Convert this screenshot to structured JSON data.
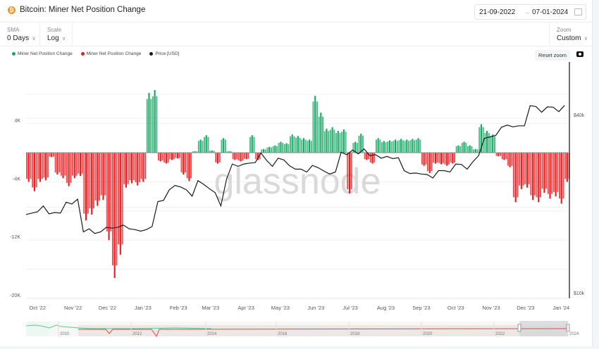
{
  "header": {
    "title": "Bitcoin: Miner Net Position Change",
    "coin_icon": "bitcoin-icon",
    "date_from": "21-09-2022",
    "date_to": "07-01-2024",
    "arrow": "→"
  },
  "controls": {
    "sma": {
      "label": "SMA",
      "value": "0 Days"
    },
    "scale": {
      "label": "Scale",
      "value": "Log"
    },
    "zoom": {
      "label": "Zoom",
      "value": "Custom"
    }
  },
  "toolbar": {
    "reset_zoom": "Reset zoom"
  },
  "legend": [
    {
      "label": "Miner Net Position Change",
      "color": "#16a864"
    },
    {
      "label": "Miner Net Position Change",
      "color": "#f0191c"
    },
    {
      "label": "Price [USD]",
      "color": "#1a1a1a"
    }
  ],
  "watermark": "glassnode",
  "chart_data": {
    "type": "bar",
    "title": "Bitcoin: Miner Net Position Change",
    "x_start": "2022-09-21",
    "x_step_days": 5,
    "ylim": [
      -20000,
      12000
    ],
    "left_ticks": [
      {
        "v": 4000,
        "label": "4K"
      },
      {
        "v": -4000,
        "label": "-4K"
      },
      {
        "v": -12000,
        "label": "-12K"
      },
      {
        "v": -20000,
        "label": "-20K"
      }
    ],
    "right_axis": {
      "scale": "log",
      "ticks": [
        {
          "v": 40000,
          "label": "$40k"
        },
        {
          "v": 10000,
          "label": "$10k"
        }
      ]
    },
    "x_ticks": [
      "Oct '22",
      "Nov '22",
      "Dec '22",
      "Jan '23",
      "Feb '23",
      "Mar '23",
      "Apr '23",
      "May '23",
      "Jun '23",
      "Jul '23",
      "Aug '23",
      "Sep '23",
      "Oct '23",
      "Nov '23",
      "Dec '23",
      "Jan '24"
    ],
    "colors": {
      "positive": "#16a864",
      "negative": "#f0191c",
      "price": "#1a1a1a"
    },
    "series": [
      {
        "name": "Miner Net Position Change",
        "values": [
          -4000,
          -5300,
          -4000,
          -3800,
          -600,
          -3000,
          -3500,
          -4600,
          -3500,
          -3200,
          -9300,
          -8500,
          -7300,
          -6500,
          -12000,
          -17200,
          -14000,
          -4800,
          -4200,
          -4500,
          -4000,
          8200,
          8600,
          -1200,
          -1500,
          -1000,
          -800,
          -3000,
          -3900,
          200,
          1800,
          2400,
          300,
          -1500,
          2000,
          200,
          -1000,
          -1200,
          -900,
          2400,
          -1000,
          500,
          800,
          1000,
          1500,
          1300,
          2500,
          2300,
          2000,
          1800,
          7800,
          5500,
          3300,
          3500,
          3000,
          3200,
          -5600,
          1500,
          2600,
          -1000,
          -1500,
          2000,
          1600,
          1700,
          1800,
          1900,
          1800,
          1900,
          2000,
          -1800,
          -2800,
          -1500,
          -1600,
          -1800,
          -1500,
          1000,
          1500,
          1000,
          500,
          3900,
          3000,
          2500,
          -500,
          -1000,
          -2000,
          -6800,
          -5000,
          -4800,
          -6500,
          -6800,
          -5500,
          -6300,
          -6000,
          -7000,
          -4000
        ]
      },
      {
        "name": "Price [USD]",
        "values": [
          18900,
          19100,
          19300,
          20200,
          19000,
          19200,
          19100,
          20800,
          20500,
          21300,
          16500,
          16900,
          16300,
          16500,
          17100,
          17000,
          17100,
          17400,
          16900,
          16800,
          16600,
          16800,
          17200,
          20900,
          21100,
          22900,
          23700,
          23400,
          22900,
          21800,
          24600,
          23900,
          23100,
          22400,
          20200,
          24900,
          28000,
          27500,
          28000,
          28200,
          28300,
          30500,
          28800,
          27500,
          29300,
          28900,
          27600,
          26900,
          26900,
          26300,
          27700,
          27200,
          26500,
          25900,
          26300,
          30700,
          30100,
          31200,
          30300,
          31500,
          29900,
          30100,
          29300,
          29700,
          29200,
          29400,
          26600,
          26000,
          26100,
          25900,
          25800,
          25100,
          26600,
          26600,
          26300,
          28000,
          27900,
          26900,
          28500,
          29900,
          34200,
          34600,
          35000,
          37300,
          37900,
          37400,
          37700,
          37700,
          44100,
          43800,
          41900,
          43700,
          43600,
          42100,
          44200
        ]
      }
    ],
    "navigator": {
      "labels": [
        "2010",
        "2012",
        "2014",
        "2016",
        "2018",
        "2020",
        "2022",
        "2024"
      ]
    }
  }
}
